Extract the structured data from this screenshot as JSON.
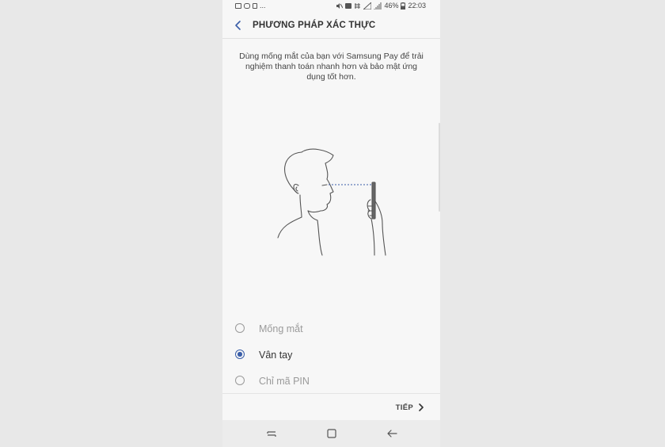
{
  "status_bar": {
    "battery": "46%",
    "time": "22:03",
    "left_icons": [
      "image-icon",
      "cloud-icon",
      "phone-icon",
      "more-dots"
    ],
    "ellipsis": "..."
  },
  "app_bar": {
    "title": "PHƯƠNG PHÁP XÁC THỰC"
  },
  "description": "Dùng mống mắt của bạn với Samsung Pay để trải nghiệm thanh toán nhanh hơn và bảo mật ứng dụng tốt hơn.",
  "options": [
    {
      "label": "Mống mắt",
      "selected": false
    },
    {
      "label": "Vân tay",
      "selected": true
    },
    {
      "label": "Chỉ mã PIN",
      "selected": false
    }
  ],
  "next_button": {
    "label": "TIẾP"
  },
  "colors": {
    "accent": "#3a5ea8",
    "background": "#f7f7f7",
    "outer": "#e8e8e8"
  }
}
